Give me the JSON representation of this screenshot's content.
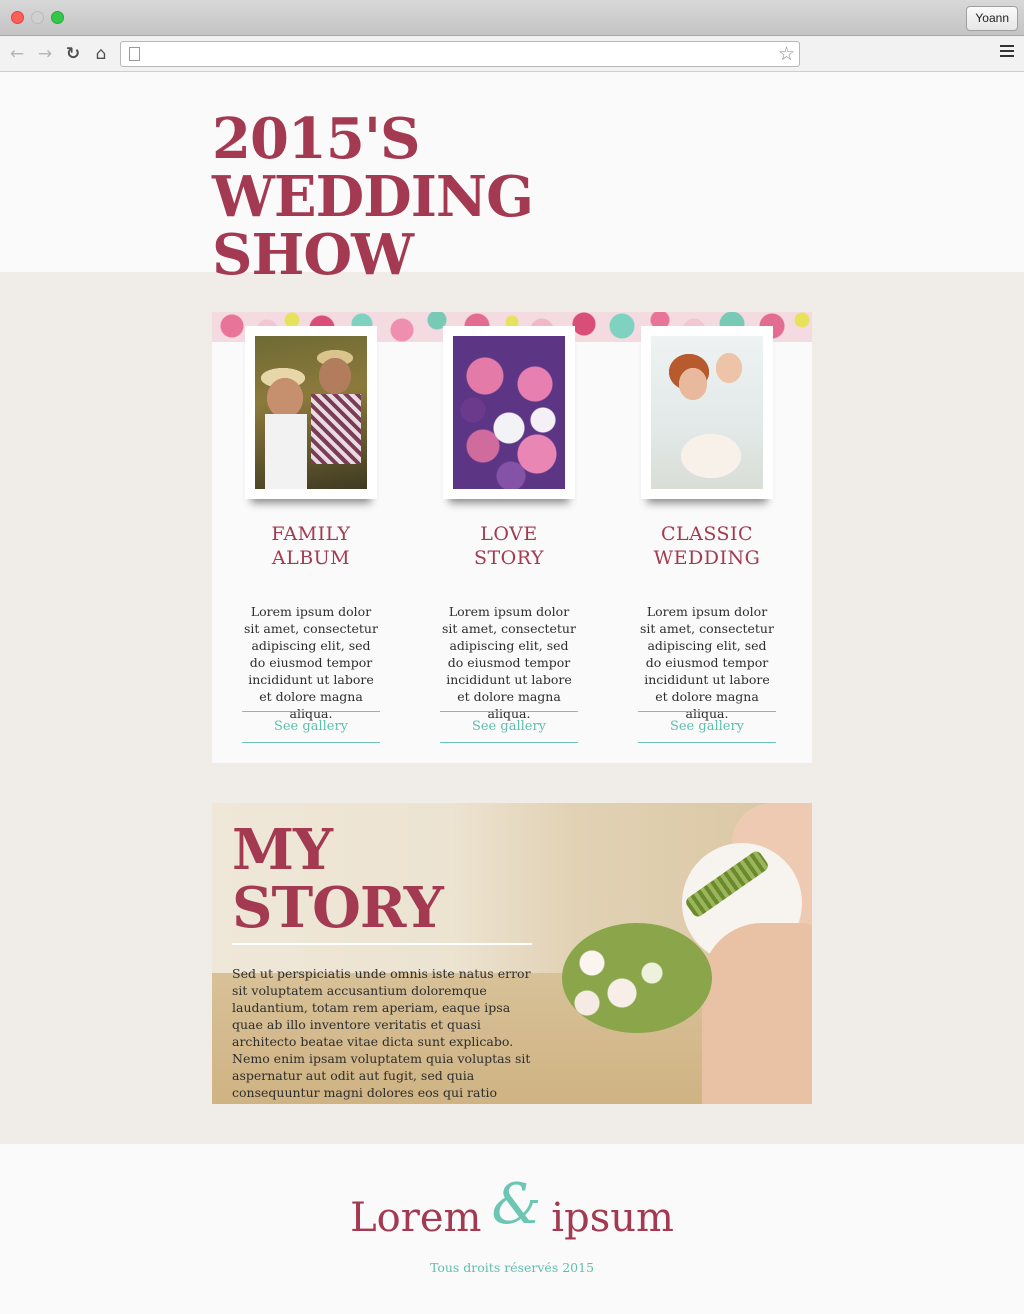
{
  "browser": {
    "profile_name": "Yoann",
    "address": ""
  },
  "header": {
    "title": "2015'S WEDDING SHOW"
  },
  "cards": [
    {
      "title_line1": "FAMILY",
      "title_line2": "ALBUM",
      "text": "Lorem ipsum dolor sit amet, consectetur adipiscing elit, sed do eiusmod tempor incididunt ut labore et dolore magna aliqua.",
      "link": "See gallery"
    },
    {
      "title_line1": "LOVE",
      "title_line2": "STORY",
      "text": "Lorem ipsum dolor sit amet, consectetur adipiscing elit, sed do eiusmod tempor incididunt ut labore et dolore magna aliqua.",
      "link": "See gallery"
    },
    {
      "title_line1": "CLASSIC",
      "title_line2": "WEDDING",
      "text": "Lorem ipsum dolor sit amet, consectetur adipiscing elit, sed do eiusmod tempor incididunt ut labore et dolore magna aliqua.",
      "link": "See gallery"
    }
  ],
  "story": {
    "title_line1": "MY",
    "title_line2": "STORY",
    "text": "Sed ut perspiciatis unde omnis iste natus error sit voluptatem accusantium doloremque laudantium, totam rem aperiam, eaque ipsa quae ab illo inventore veritatis et quasi architecto beatae vitae dicta sunt explicabo. Nemo enim ipsam voluptatem quia voluptas sit aspernatur aut odit aut fugit, sed quia consequuntur magni dolores eos qui ratio"
  },
  "footer": {
    "brand_left": "Lorem",
    "brand_amp": "&",
    "brand_right": "ipsum",
    "copyright": "Tous droits réservés 2015"
  },
  "colors": {
    "accent": "#a33a52",
    "teal": "#6cc6b3",
    "page_bg": "#f0ece7"
  },
  "icons": [
    "back-arrow-icon",
    "forward-arrow-icon",
    "reload-icon",
    "home-icon",
    "page-icon",
    "star-icon",
    "menu-icon"
  ]
}
